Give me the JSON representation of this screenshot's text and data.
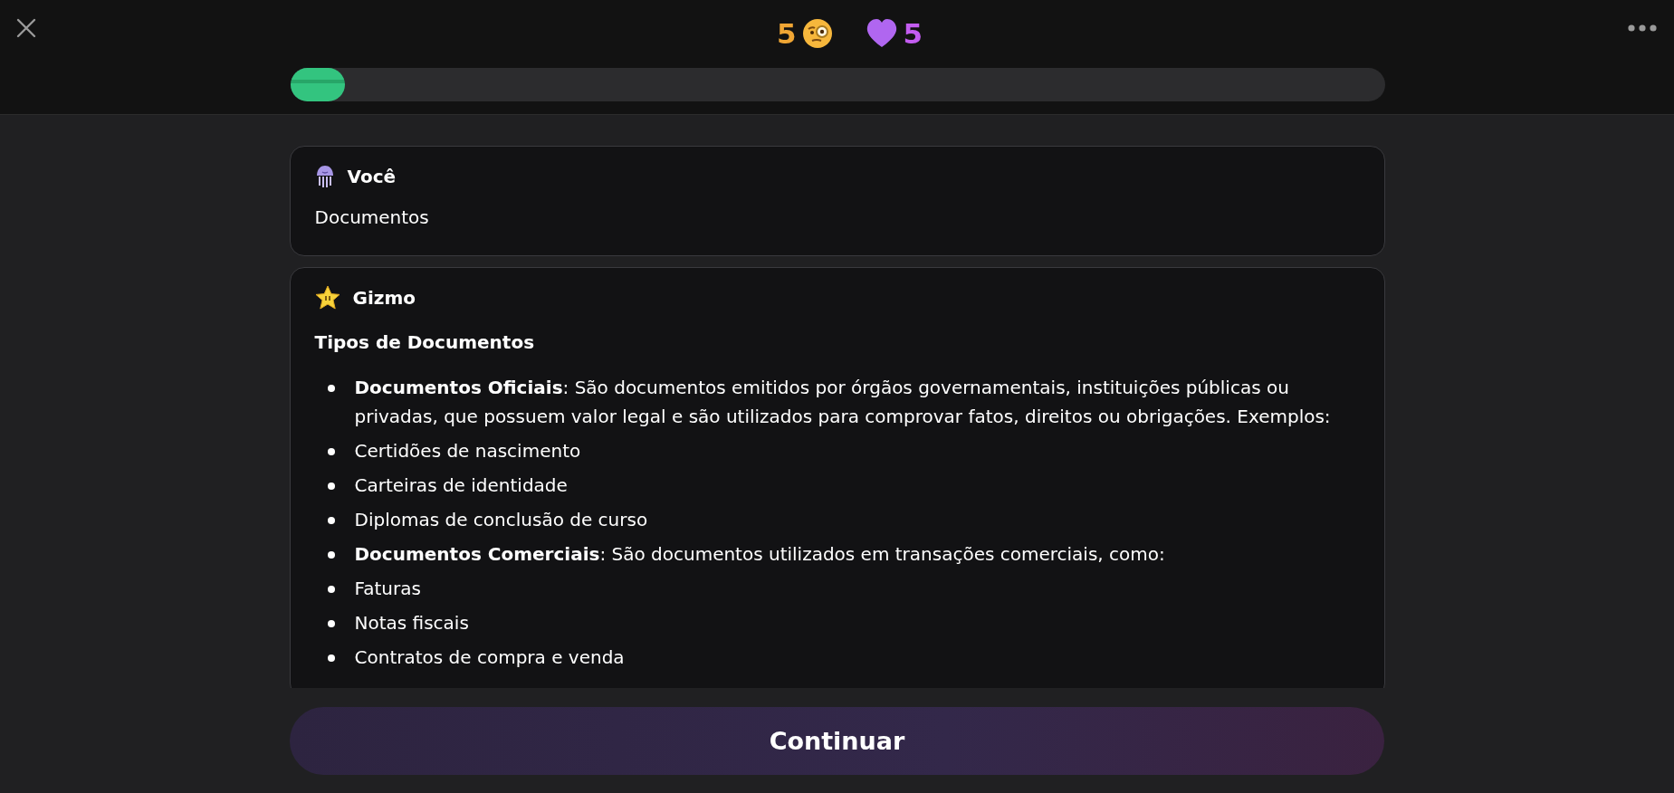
{
  "stats": [
    {
      "kind": "streak",
      "value": "5"
    },
    {
      "kind": "lives",
      "value": "5"
    }
  ],
  "progress": {
    "level": 0.05
  },
  "messages": [
    {
      "kind": "user",
      "author": "Você",
      "text": "Documentos"
    },
    {
      "kind": "assistant",
      "author": "Gizmo",
      "heading": "Tipos de Documentos",
      "items": [
        "**Documentos Oficiais**: São documentos emitidos por órgãos governamentais, instituições públicas ou privadas, que possuem valor legal e são utilizados para comprovar fatos, direitos ou obrigações. Exemplos:",
        "Certidões de nascimento",
        "Carteiras de identidade",
        "Diplomas de conclusão de curso",
        "**Documentos Comerciais**: São documentos utilizados em transações comerciais, como:",
        "Faturas",
        "Notas fiscais",
        "Contratos de compra e venda"
      ]
    }
  ],
  "button": {
    "label": "Continuar"
  }
}
